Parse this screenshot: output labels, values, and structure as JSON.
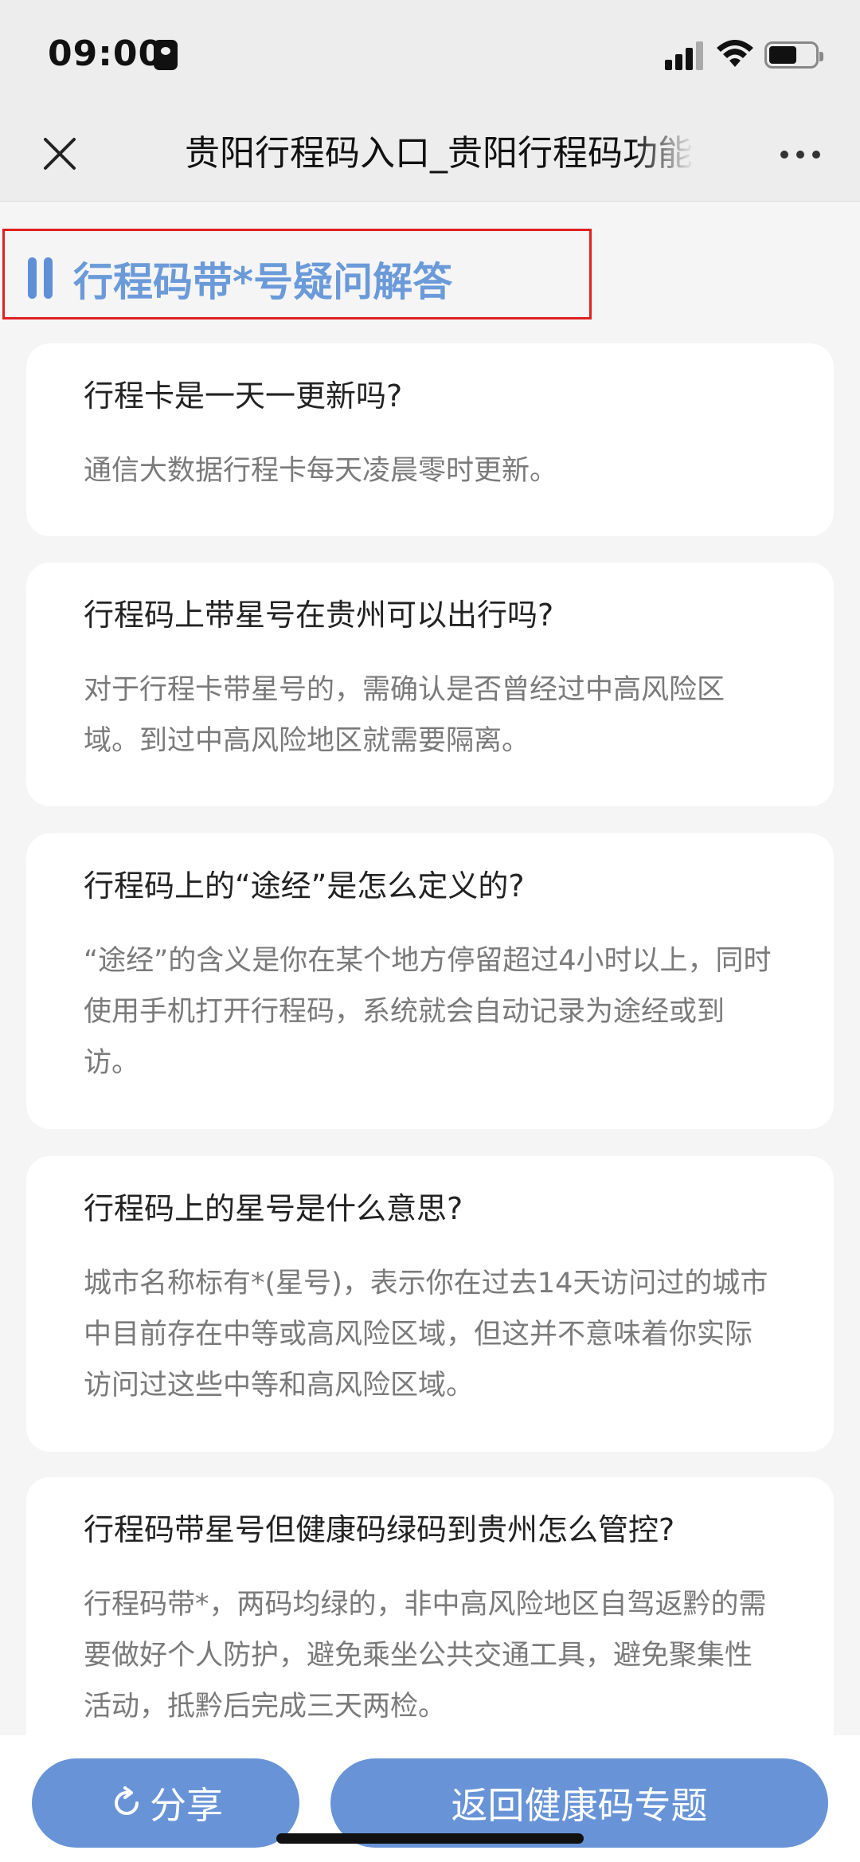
{
  "status_bar": {
    "time": "09:00"
  },
  "nav": {
    "title": "贵阳行程码入口_贵阳行程码功能"
  },
  "section": {
    "title": "行程码带*号疑问解答"
  },
  "faq": [
    {
      "question": "行程卡是一天一更新吗?",
      "answer": "通信大数据行程卡每天凌晨零时更新。"
    },
    {
      "question": "行程码上带星号在贵州可以出行吗?",
      "answer": "对于行程卡带星号的，需确认是否曾经过中高风险区域。到过中高风险地区就需要隔离。"
    },
    {
      "question": "行程码上的“途经”是怎么定义的?",
      "answer": "“途经”的含义是你在某个地方停留超过4小时以上，同时使用手机打开行程码，系统就会自动记录为途经或到访。"
    },
    {
      "question": "行程码上的星号是什么意思?",
      "answer": "城市名称标有*(星号)，表示你在过去14天访问过的城市中目前存在中等或高风险区域，但这并不意味着你实际访问过这些中等和高风险区域。"
    },
    {
      "question": "行程码带星号但健康码绿码到贵州怎么管控?",
      "answer": "行程码带*，两码均绿的，非中高风险地区自驾返黔的需要做好个人防护，避免乘坐公共交通工具，避免聚集性活动，抵黔后完成三天两检。"
    }
  ],
  "bottom": {
    "share_label": "分享",
    "back_label": "返回健康码专题"
  },
  "colors": {
    "accent": "#6894d7",
    "section_title": "#6b9ad9",
    "highlight_border": "#e02020"
  }
}
